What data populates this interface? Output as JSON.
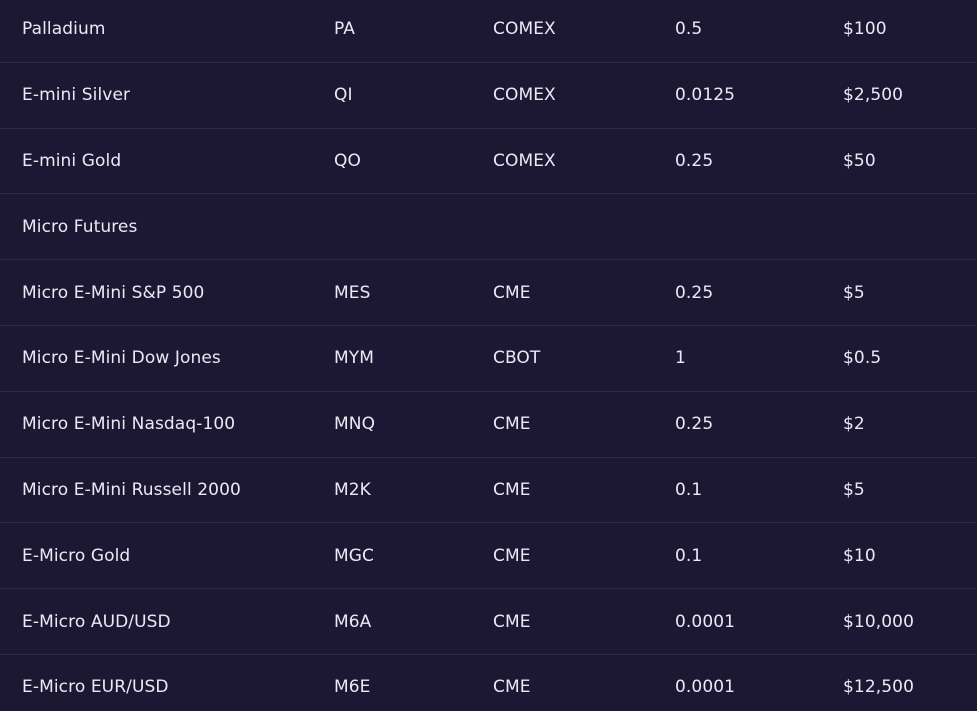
{
  "table": {
    "rows": [
      {
        "name": "Palladium",
        "symbol": "PA",
        "exchange": "COMEX",
        "tick_size": "0.5",
        "tick_value": "$100"
      },
      {
        "name": "E-mini Silver",
        "symbol": "QI",
        "exchange": "COMEX",
        "tick_size": "0.0125",
        "tick_value": "$2,500"
      },
      {
        "name": "E-mini Gold",
        "symbol": "QO",
        "exchange": "COMEX",
        "tick_size": "0.25",
        "tick_value": "$50"
      },
      {
        "name": "Micro Futures",
        "symbol": "",
        "exchange": "",
        "tick_size": "",
        "tick_value": ""
      },
      {
        "name": "Micro E-Mini S&P 500",
        "symbol": "MES",
        "exchange": "CME",
        "tick_size": "0.25",
        "tick_value": "$5"
      },
      {
        "name": "Micro E-Mini Dow Jones",
        "symbol": "MYM",
        "exchange": "CBOT",
        "tick_size": "1",
        "tick_value": "$0.5"
      },
      {
        "name": "Micro E-Mini Nasdaq-100",
        "symbol": "MNQ",
        "exchange": "CME",
        "tick_size": "0.25",
        "tick_value": "$2"
      },
      {
        "name": "Micro E-Mini Russell 2000",
        "symbol": "M2K",
        "exchange": "CME",
        "tick_size": "0.1",
        "tick_value": "$5"
      },
      {
        "name": "E-Micro Gold",
        "symbol": "MGC",
        "exchange": "CME",
        "tick_size": "0.1",
        "tick_value": "$10"
      },
      {
        "name": "E-Micro AUD/USD",
        "symbol": "M6A",
        "exchange": "CME",
        "tick_size": "0.0001",
        "tick_value": "$10,000"
      },
      {
        "name": "E-Micro EUR/USD",
        "symbol": "M6E",
        "exchange": "CME",
        "tick_size": "0.0001",
        "tick_value": "$12,500"
      }
    ]
  },
  "colors": {
    "background": "#1c1834",
    "divider": "#2e2a47",
    "text": "#ece9f4"
  }
}
